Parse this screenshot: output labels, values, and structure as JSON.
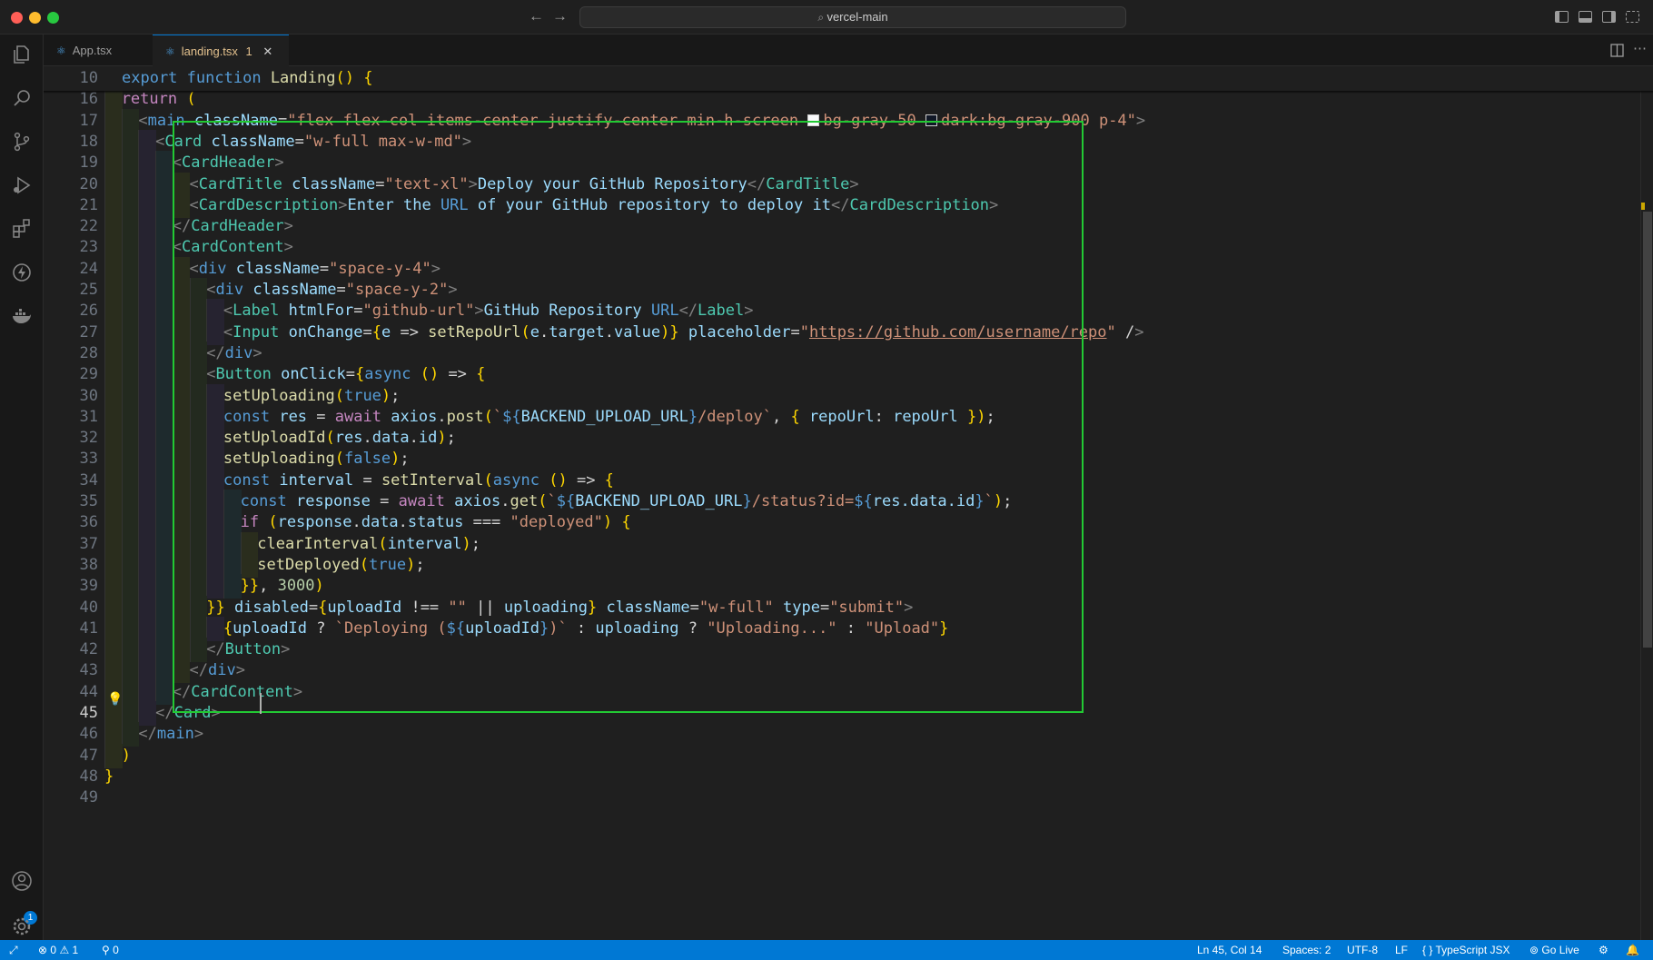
{
  "window": {
    "command_center": "vercel-main"
  },
  "tabs": [
    {
      "label": "App.tsx",
      "active": false
    },
    {
      "label": "landing.tsx",
      "problems": "1",
      "active": true
    }
  ],
  "editor": {
    "sticky_line_number": "10",
    "sticky_text": "export function Landing() {",
    "line_numbers": [
      "16",
      "17",
      "18",
      "19",
      "20",
      "21",
      "22",
      "23",
      "24",
      "25",
      "26",
      "27",
      "28",
      "29",
      "30",
      "31",
      "32",
      "33",
      "34",
      "35",
      "36",
      "37",
      "38",
      "39",
      "40",
      "41",
      "42",
      "43",
      "44",
      "45",
      "46",
      "47",
      "48",
      "49"
    ],
    "cursor_line": "45",
    "code_lines": [
      "return (",
      "<main className=\"flex flex-col items-center justify-center min-h-screen bg-gray-50 dark:bg-gray-900 p-4\">",
      "<Card className=\"w-full max-w-md\">",
      "<CardHeader>",
      "<CardTitle className=\"text-xl\">Deploy your GitHub Repository</CardTitle>",
      "<CardDescription>Enter the URL of your GitHub repository to deploy it</CardDescription>",
      "</CardHeader>",
      "<CardContent>",
      "<div className=\"space-y-4\">",
      "<div className=\"space-y-2\">",
      "<Label htmlFor=\"github-url\">GitHub Repository URL</Label>",
      "<Input onChange={e => setRepoUrl(e.target.value)} placeholder=\"https://github.com/username/repo\" />",
      "</div>",
      "<Button onClick={async () => {",
      "setUploading(true);",
      "const res = await axios.post(`${BACKEND_UPLOAD_URL}/deploy`, { repoUrl: repoUrl });",
      "setUploadId(res.data.id);",
      "setUploading(false);",
      "const interval = setInterval(async () => {",
      "const response = await axios.get(`${BACKEND_UPLOAD_URL}/status?id=${res.data.id}`);",
      "if (response.data.status === \"deployed\") {",
      "clearInterval(interval);",
      "setDeployed(true);",
      "}}, 3000)",
      "}} disabled={uploadId !== \"\" || uploading} className=\"w-full\" type=\"submit\">",
      "{uploadId ? `Deploying (${uploadId})` : uploading ? \"Uploading...\" : \"Upload\"}",
      "</Button>",
      "</div>",
      "</CardContent>",
      "</Card>",
      "</main>",
      ")",
      "}",
      ""
    ]
  },
  "statusbar": {
    "errors": "0",
    "warnings": "1",
    "ports": "0",
    "position": "Ln 45, Col 14",
    "spaces": "Spaces: 2",
    "encoding": "UTF-8",
    "eol": "LF",
    "language": "TypeScript JSX",
    "go_live": "Go Live"
  },
  "activity_bar": {
    "icons": [
      "explorer-icon",
      "search-icon",
      "source-control-icon",
      "run-debug-icon",
      "extensions-icon",
      "remote-icon",
      "docker-icon",
      "account-icon",
      "settings-icon"
    ],
    "account_badge": "1"
  },
  "colors": {
    "accent": "#0078d4",
    "highlight_box": "#22c933",
    "editor_bg": "#1f1f1f"
  }
}
